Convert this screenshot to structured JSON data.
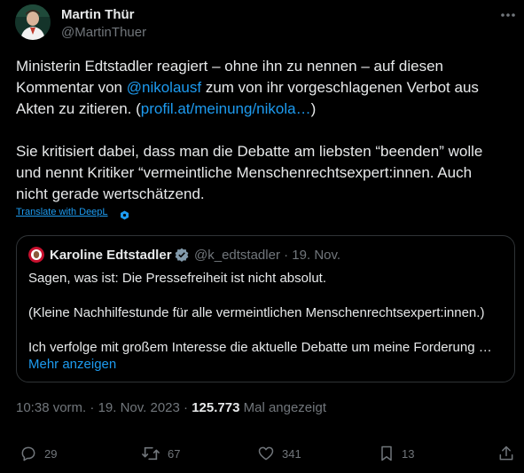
{
  "author": {
    "display_name": "Martin Thür",
    "handle": "@MartinThuer"
  },
  "tweet": {
    "line1": "Ministerin Edtstadler reagiert – ohne ihn zu nennen – auf diesen",
    "line2_before": "Kommentar von ",
    "mention": "@nikolausf",
    "line2_after": " zum von ihr vorgeschlagenen Verbot aus",
    "line3_before": "Akten zu zitieren. (",
    "link": "profil.at/meinung/nikola…",
    "line3_after": ")",
    "para2_line1": "Sie kritisiert dabei, dass man die Debatte am liebsten “beenden” wolle",
    "para2_line2": "und nennt Kritiker “vermeintliche Menschenrechtsexpert:innen. Auch",
    "para2_line3": "nicht gerade wertschätzend."
  },
  "translate_label": "Translate with DeepL",
  "quote": {
    "display_name": "Karoline Edtstadler",
    "handle": "@k_edtstadler",
    "separator": "·",
    "date": "19. Nov.",
    "line1": "Sagen, was ist: Die Pressefreiheit ist nicht absolut.",
    "line2": "(Kleine Nachhilfestunde für alle vermeintlichen Menschenrechtsexpert:innen.)",
    "line3": "Ich verfolge mit großem Interesse die aktuelle Debatte um meine Forderung …",
    "show_more": "Mehr anzeigen"
  },
  "meta": {
    "time": "10:38 vorm.",
    "sep1": " · ",
    "date": "19. Nov. 2023",
    "sep2": " · ",
    "views": "125.773",
    "views_label": " Mal angezeigt"
  },
  "actions": {
    "replies": "29",
    "reposts": "67",
    "likes": "341",
    "bookmarks": "13"
  },
  "icons": {
    "more": "more-icon",
    "deepl": "deepl-icon",
    "verified": "verified-badge-icon",
    "reply": "reply-icon",
    "repost": "repost-icon",
    "like": "like-icon",
    "bookmark": "bookmark-icon",
    "share": "share-icon"
  },
  "colors": {
    "background": "#000000",
    "text": "#e7e9ea",
    "muted": "#71767b",
    "link": "#1d9bf0",
    "border": "#2f3336",
    "verified_gold": "#e2b719"
  }
}
